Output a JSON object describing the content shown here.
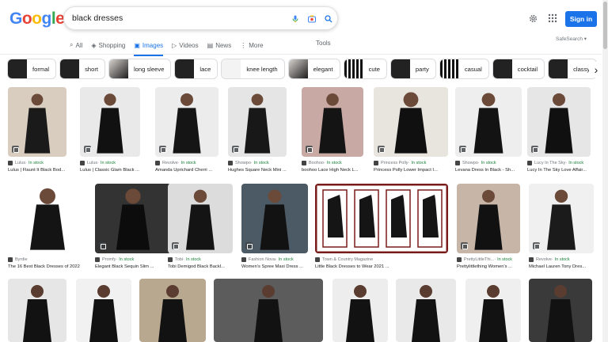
{
  "logo": {
    "letters": [
      "G",
      "o",
      "o",
      "g",
      "l",
      "e"
    ],
    "colors": [
      "#4285F4",
      "#EA4335",
      "#FBBC05",
      "#4285F4",
      "#34A853",
      "#EA4335"
    ]
  },
  "search": {
    "value": "black dresses"
  },
  "header": {
    "signin_label": "Sign in",
    "settings_icon": "gear-icon",
    "apps_icon": "apps-grid-icon"
  },
  "tabs": [
    {
      "label": "All",
      "icon": "search-icon",
      "active": false
    },
    {
      "label": "Shopping",
      "icon": "tag-icon",
      "active": false
    },
    {
      "label": "Images",
      "icon": "image-icon",
      "active": true
    },
    {
      "label": "Videos",
      "icon": "play-icon",
      "active": false
    },
    {
      "label": "News",
      "icon": "news-icon",
      "active": false
    },
    {
      "label": "More",
      "icon": "more-icon",
      "active": false
    }
  ],
  "tools_label": "Tools",
  "safesearch_label": "SafeSearch",
  "chips": [
    {
      "label": "formal"
    },
    {
      "label": "short"
    },
    {
      "label": "long sleeve"
    },
    {
      "label": "lace"
    },
    {
      "label": "knee length"
    },
    {
      "label": "elegant"
    },
    {
      "label": "cute"
    },
    {
      "label": "party"
    },
    {
      "label": "casual"
    },
    {
      "label": "cocktail"
    },
    {
      "label": "classy"
    }
  ],
  "results": [
    {
      "source": "Lulus",
      "stock": "In stock",
      "title": "Lulus | Flaunt It Black Bod..."
    },
    {
      "source": "Lulus",
      "stock": "In stock",
      "title": "Lulus | Classic Glam Black ..."
    },
    {
      "source": "Revolve",
      "stock": "In stock",
      "title": "Amanda Uprichard Cherri ..."
    },
    {
      "source": "Showpo",
      "stock": "In stock",
      "title": "Hughes Square Neck Mini ..."
    },
    {
      "source": "Boohoo",
      "stock": "In stock",
      "title": "boohoo Lace High Neck L..."
    },
    {
      "source": "Princess Polly",
      "stock": "In stock",
      "title": "Princess Polly Lower Impact I..."
    },
    {
      "source": "Showpo",
      "stock": "In stock",
      "title": "Levana Dress In Black - Sh..."
    },
    {
      "source": "Lucy In The Sky",
      "stock": "In stock",
      "title": "Lucy In The Sky Love Affair..."
    },
    {
      "source": "Byrdie",
      "stock": "",
      "title": "The 16 Best Black Dresses of 2022"
    },
    {
      "source": "Promfy",
      "stock": "In stock",
      "title": "Elegant Black Sequin Slim ..."
    },
    {
      "source": "Tobi",
      "stock": "In stock",
      "title": "Tobi Demigod Black Backl..."
    },
    {
      "source": "Fashion Nova",
      "stock": "In stock",
      "title": "Women's Spree Maxi Dress ..."
    },
    {
      "source": "Town & Country Magazine",
      "stock": "",
      "title": "Little Black Dresses to Wear 2021 ..."
    },
    {
      "source": "PrettyLittleThi...",
      "stock": "In stock",
      "title": "Prettylittlething Women's ..."
    },
    {
      "source": "Revolve",
      "stock": "In stock",
      "title": "Michael Lauren Tony Dres..."
    }
  ],
  "colors": {
    "accent": "#1a73e8",
    "stock": "#188038",
    "text_secondary": "#70757a"
  }
}
